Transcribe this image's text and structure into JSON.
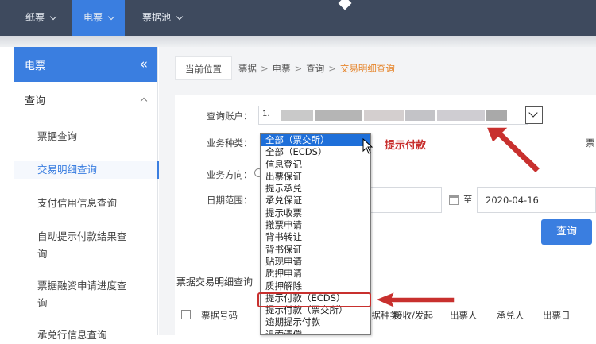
{
  "topbar": {
    "tabs": [
      {
        "label": "纸票",
        "active": false
      },
      {
        "label": "电票",
        "active": true
      },
      {
        "label": "票据池",
        "active": false
      }
    ]
  },
  "sidebar": {
    "title": "电票",
    "collapse_glyph": "«",
    "group": "查询",
    "items": [
      {
        "label": "票据查询",
        "active": false
      },
      {
        "label": "交易明细查询",
        "active": true
      },
      {
        "label": "支付信用信息查询",
        "active": false
      },
      {
        "label": "自动提示付款结果查询",
        "active": false
      },
      {
        "label": "票据融资申请进度查询",
        "active": false
      },
      {
        "label": "承兑行信息查询",
        "active": false
      }
    ]
  },
  "breadcrumb": {
    "current_label": "当前位置",
    "path": [
      "票据",
      "电票",
      "查询"
    ],
    "current": "交易明细查询"
  },
  "form": {
    "account_label": "查询账户：",
    "account_prefix": "1.",
    "biz_type_label": "业务种类：",
    "direction_label": "业务方向：",
    "date_label": "日期范围：",
    "date_to_label": "至",
    "date_end": "2020-04-16",
    "right_edge_label": "票",
    "query_button": "查询"
  },
  "dropdown": {
    "selected": "全部（票交所）",
    "options": [
      "全部（ECDS）",
      "信息登记",
      "出票保证",
      "提示承兑",
      "承兑保证",
      "提示收票",
      "撤票申请",
      "背书转让",
      "背书保证",
      "贴现申请",
      "质押申请",
      "质押解除",
      "提示付款（ECDS）",
      "提示付款（票交所）",
      "逾期提示付款",
      "追索清偿"
    ],
    "highlighted": "提示付款（ECDS）"
  },
  "annotation": {
    "text": "提示付款",
    "color": "#c8302e"
  },
  "result": {
    "title": "票据交易明细查询",
    "columns": [
      "票据号码",
      "票据种类",
      "接收/发起",
      "出票人",
      "承兑人",
      "出票日"
    ]
  },
  "colors": {
    "accent": "#3a7ee0",
    "topbar": "#3e4a5e",
    "highlight_red": "#c8302e",
    "breadcrumb_current": "#e6862d"
  }
}
